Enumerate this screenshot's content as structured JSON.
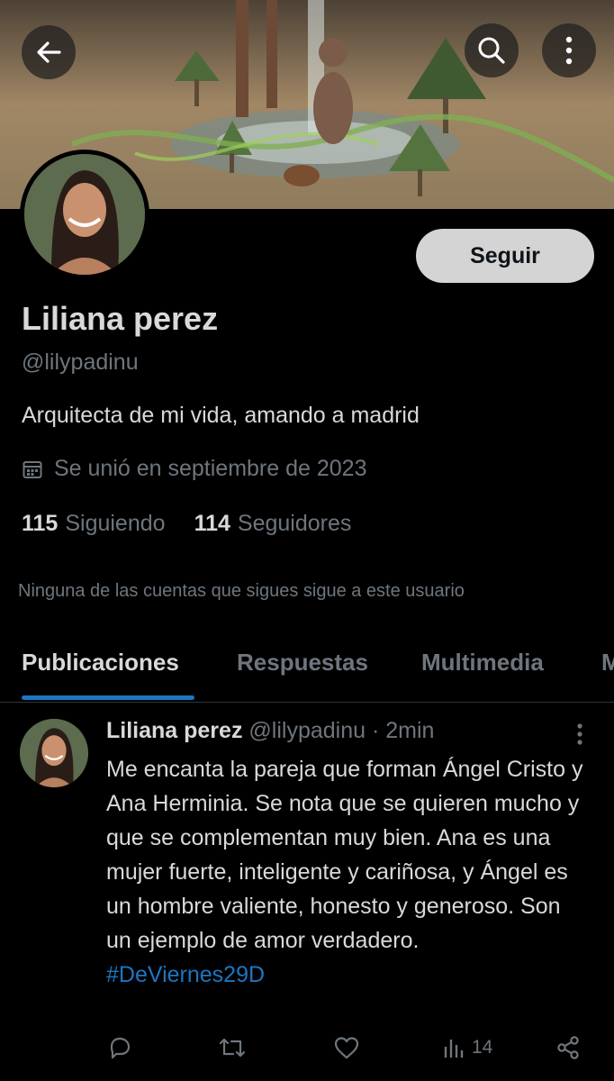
{
  "profile": {
    "name": "Liliana perez",
    "handle": "@lilypadinu",
    "bio": "Arquitecta de mi vida, amando a madrid",
    "joined": "Se unió en septiembre de 2023",
    "following_count": "115",
    "following_label": "Siguiendo",
    "followers_count": "114",
    "followers_label": "Seguidores",
    "mutuals_note": "Ninguna de las cuentas que sigues sigue a este usuario"
  },
  "follow_button": "Seguir",
  "tabs": [
    {
      "label": "Publicaciones",
      "active": true
    },
    {
      "label": "Respuestas"
    },
    {
      "label": "Multimedia"
    },
    {
      "label": "M"
    }
  ],
  "post": {
    "author": "Liliana perez",
    "meta": "@lilypadinu · 2min",
    "text": "Me encanta la pareja que forman Ángel Cristo y Ana Herminia. Se nota que se quieren mucho y que se complementan muy bien. Ana es una mujer fuerte, inteligente y cariñosa, y Ángel es un hombre valiente, honesto y generoso. Son un ejemplo de amor verdadero.",
    "hashtag": "#DeViernes29D",
    "views": "14"
  },
  "icons": [
    "back-arrow-icon",
    "search-icon",
    "more-vertical-icon",
    "calendar-icon",
    "reply-icon",
    "repost-icon",
    "like-icon",
    "views-icon",
    "share-icon"
  ],
  "colors": {
    "accent": "#1d76c2",
    "muted": "#6e767d",
    "text": "#d9d9d9",
    "background": "#000000"
  }
}
